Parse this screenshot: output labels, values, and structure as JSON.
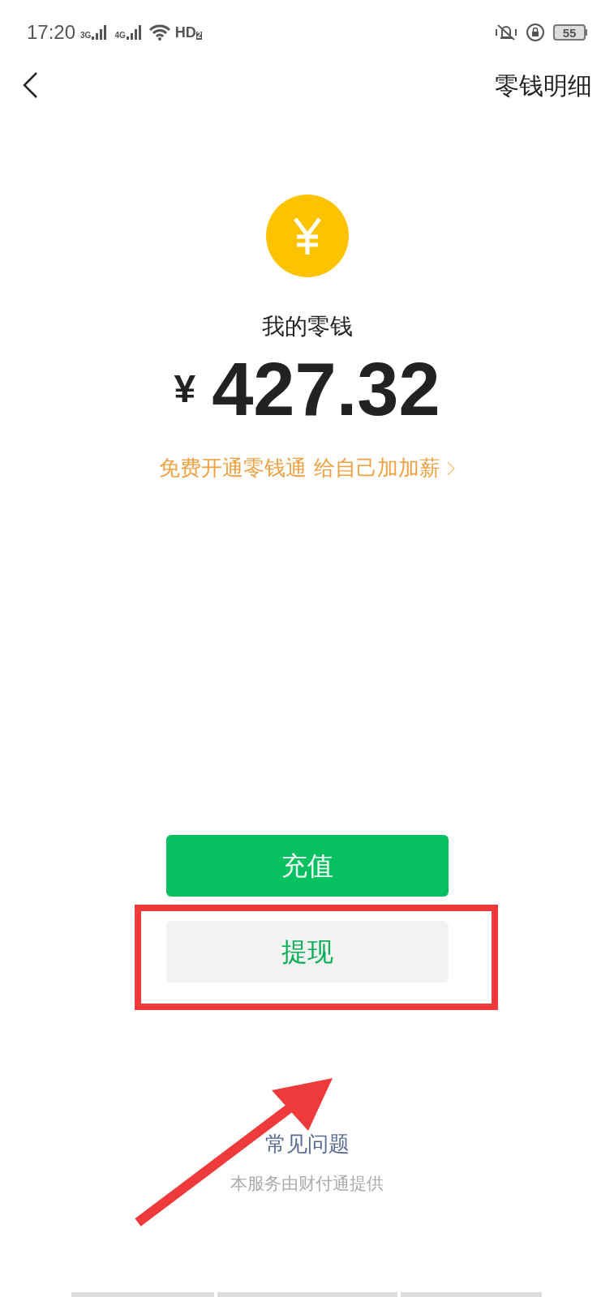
{
  "status_bar": {
    "time": "17:20",
    "sim1": "3G",
    "sim2": "4G",
    "hd": "HD",
    "hd_slot": "2",
    "battery": "55"
  },
  "nav": {
    "title": "零钱明细"
  },
  "balance": {
    "label": "我的零钱",
    "currency": "¥",
    "amount": "427.32",
    "promo": "免费开通零钱通 给自己加加薪"
  },
  "buttons": [
    {
      "label": "充值",
      "kind": "primary"
    },
    {
      "label": "提现",
      "kind": "secondary",
      "highlighted": true
    }
  ],
  "footer": {
    "faq": "常见问题",
    "provider": "本服务由财付通提供"
  }
}
